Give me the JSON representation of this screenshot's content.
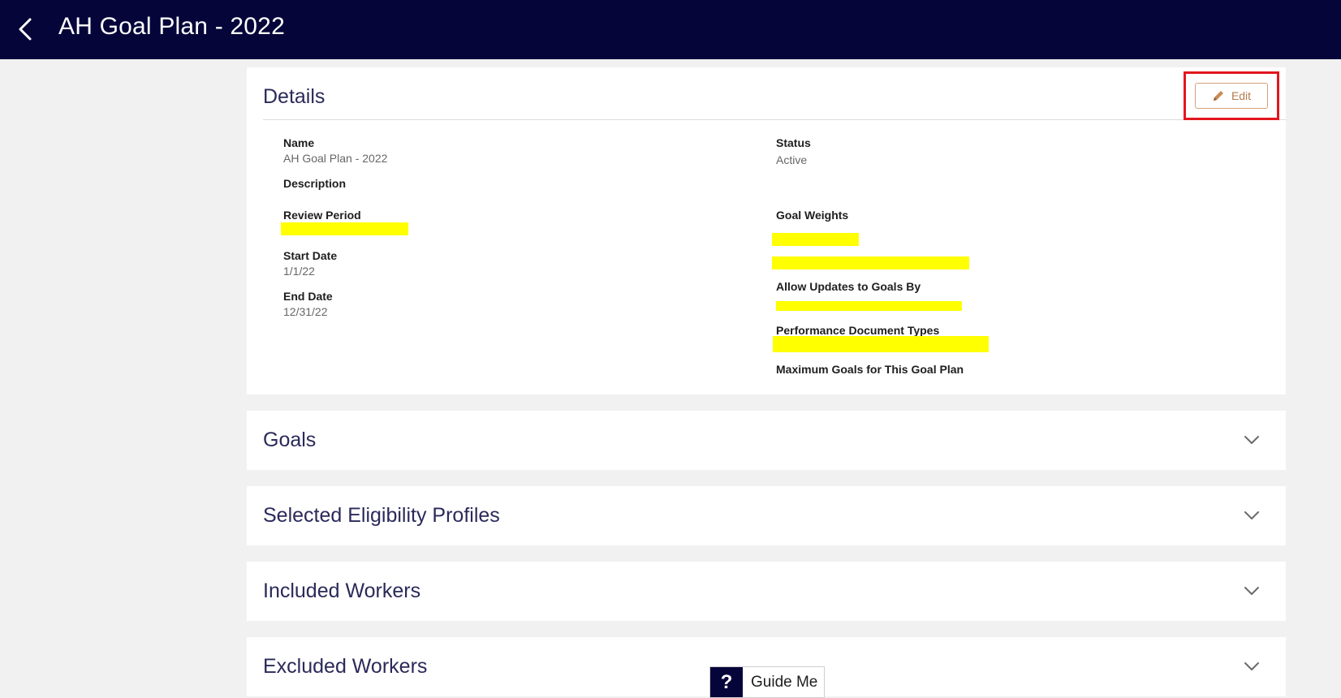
{
  "header": {
    "title": "AH Goal Plan - 2022",
    "back_icon": "chevron-left-icon"
  },
  "details": {
    "title": "Details",
    "edit_label": "Edit",
    "edit_icon": "pencil-icon",
    "left_fields": [
      {
        "label": "Name",
        "value": "AH Goal Plan - 2022"
      },
      {
        "label": "Description",
        "value": ""
      },
      {
        "label": "Review Period",
        "value": ""
      },
      {
        "label": "Start Date",
        "value": "1/1/22"
      },
      {
        "label": "End Date",
        "value": "12/31/22"
      }
    ],
    "right_fields": [
      {
        "label": "Status",
        "value": "Active"
      },
      {
        "label": "Goal Weights",
        "value": ""
      },
      {
        "label": "Allow Updates to Goals By",
        "value": ""
      },
      {
        "label": "Performance Document Types",
        "value": ""
      },
      {
        "label": "Maximum Goals for This Goal Plan",
        "value": ""
      }
    ],
    "redaction_color": "#ffff00",
    "highlight_color": "#e2161e"
  },
  "sections": [
    {
      "title": "Goals",
      "icon": "chevron-down-icon"
    },
    {
      "title": "Selected Eligibility Profiles",
      "icon": "chevron-down-icon"
    },
    {
      "title": "Included Workers",
      "icon": "chevron-down-icon"
    },
    {
      "title": "Excluded Workers",
      "icon": "chevron-down-icon"
    }
  ],
  "guide": {
    "icon": "?",
    "label": "Guide Me"
  },
  "colors": {
    "topbar": "#05053a",
    "background": "#f1f1f1",
    "title_text": "#2a2a5a",
    "edit_accent": "#b47c4c"
  }
}
